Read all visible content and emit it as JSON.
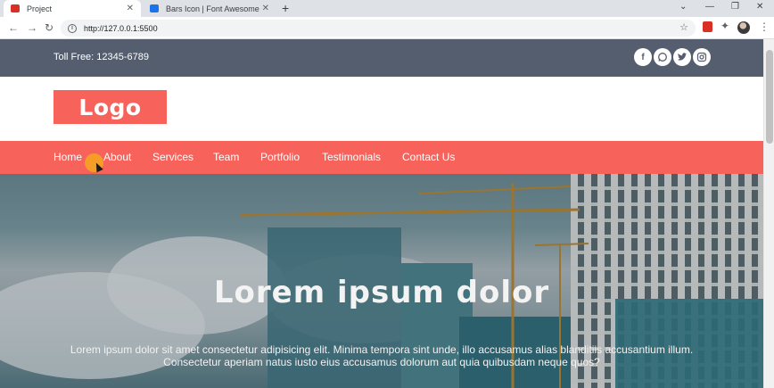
{
  "browser": {
    "tabs": [
      {
        "title": "Project",
        "favicon_color": "#d93025"
      },
      {
        "title": "Bars Icon | Font Awesome",
        "favicon_color": "#1a73e8"
      }
    ],
    "new_tab_label": "+",
    "url": "http://127.0.0.1:5500",
    "window_controls": {
      "minimize": "—",
      "restore": "❐",
      "close": "✕"
    }
  },
  "topbar": {
    "toll_free": "Toll Free: 12345-6789",
    "social_icons": [
      "facebook-icon",
      "whatsapp-icon",
      "twitter-icon",
      "instagram-icon"
    ]
  },
  "logo": {
    "text": "Logo"
  },
  "nav": {
    "items": [
      "Home",
      "About",
      "Services",
      "Team",
      "Portfolio",
      "Testimonials",
      "Contact Us"
    ]
  },
  "hero": {
    "title": "Lorem ipsum dolor",
    "text_line1": "Lorem ipsum dolor sit amet consectetur adipisicing elit. Minima tempora sint unde, illo accusamus alias blanditiis accusantium illum.",
    "text_line2": "Consectetur aperiam natus iusto eius accusamus dolorum aut quia quibusdam neque quos?"
  },
  "colors": {
    "accent": "#f7625a",
    "topbar": "#545e6f"
  }
}
